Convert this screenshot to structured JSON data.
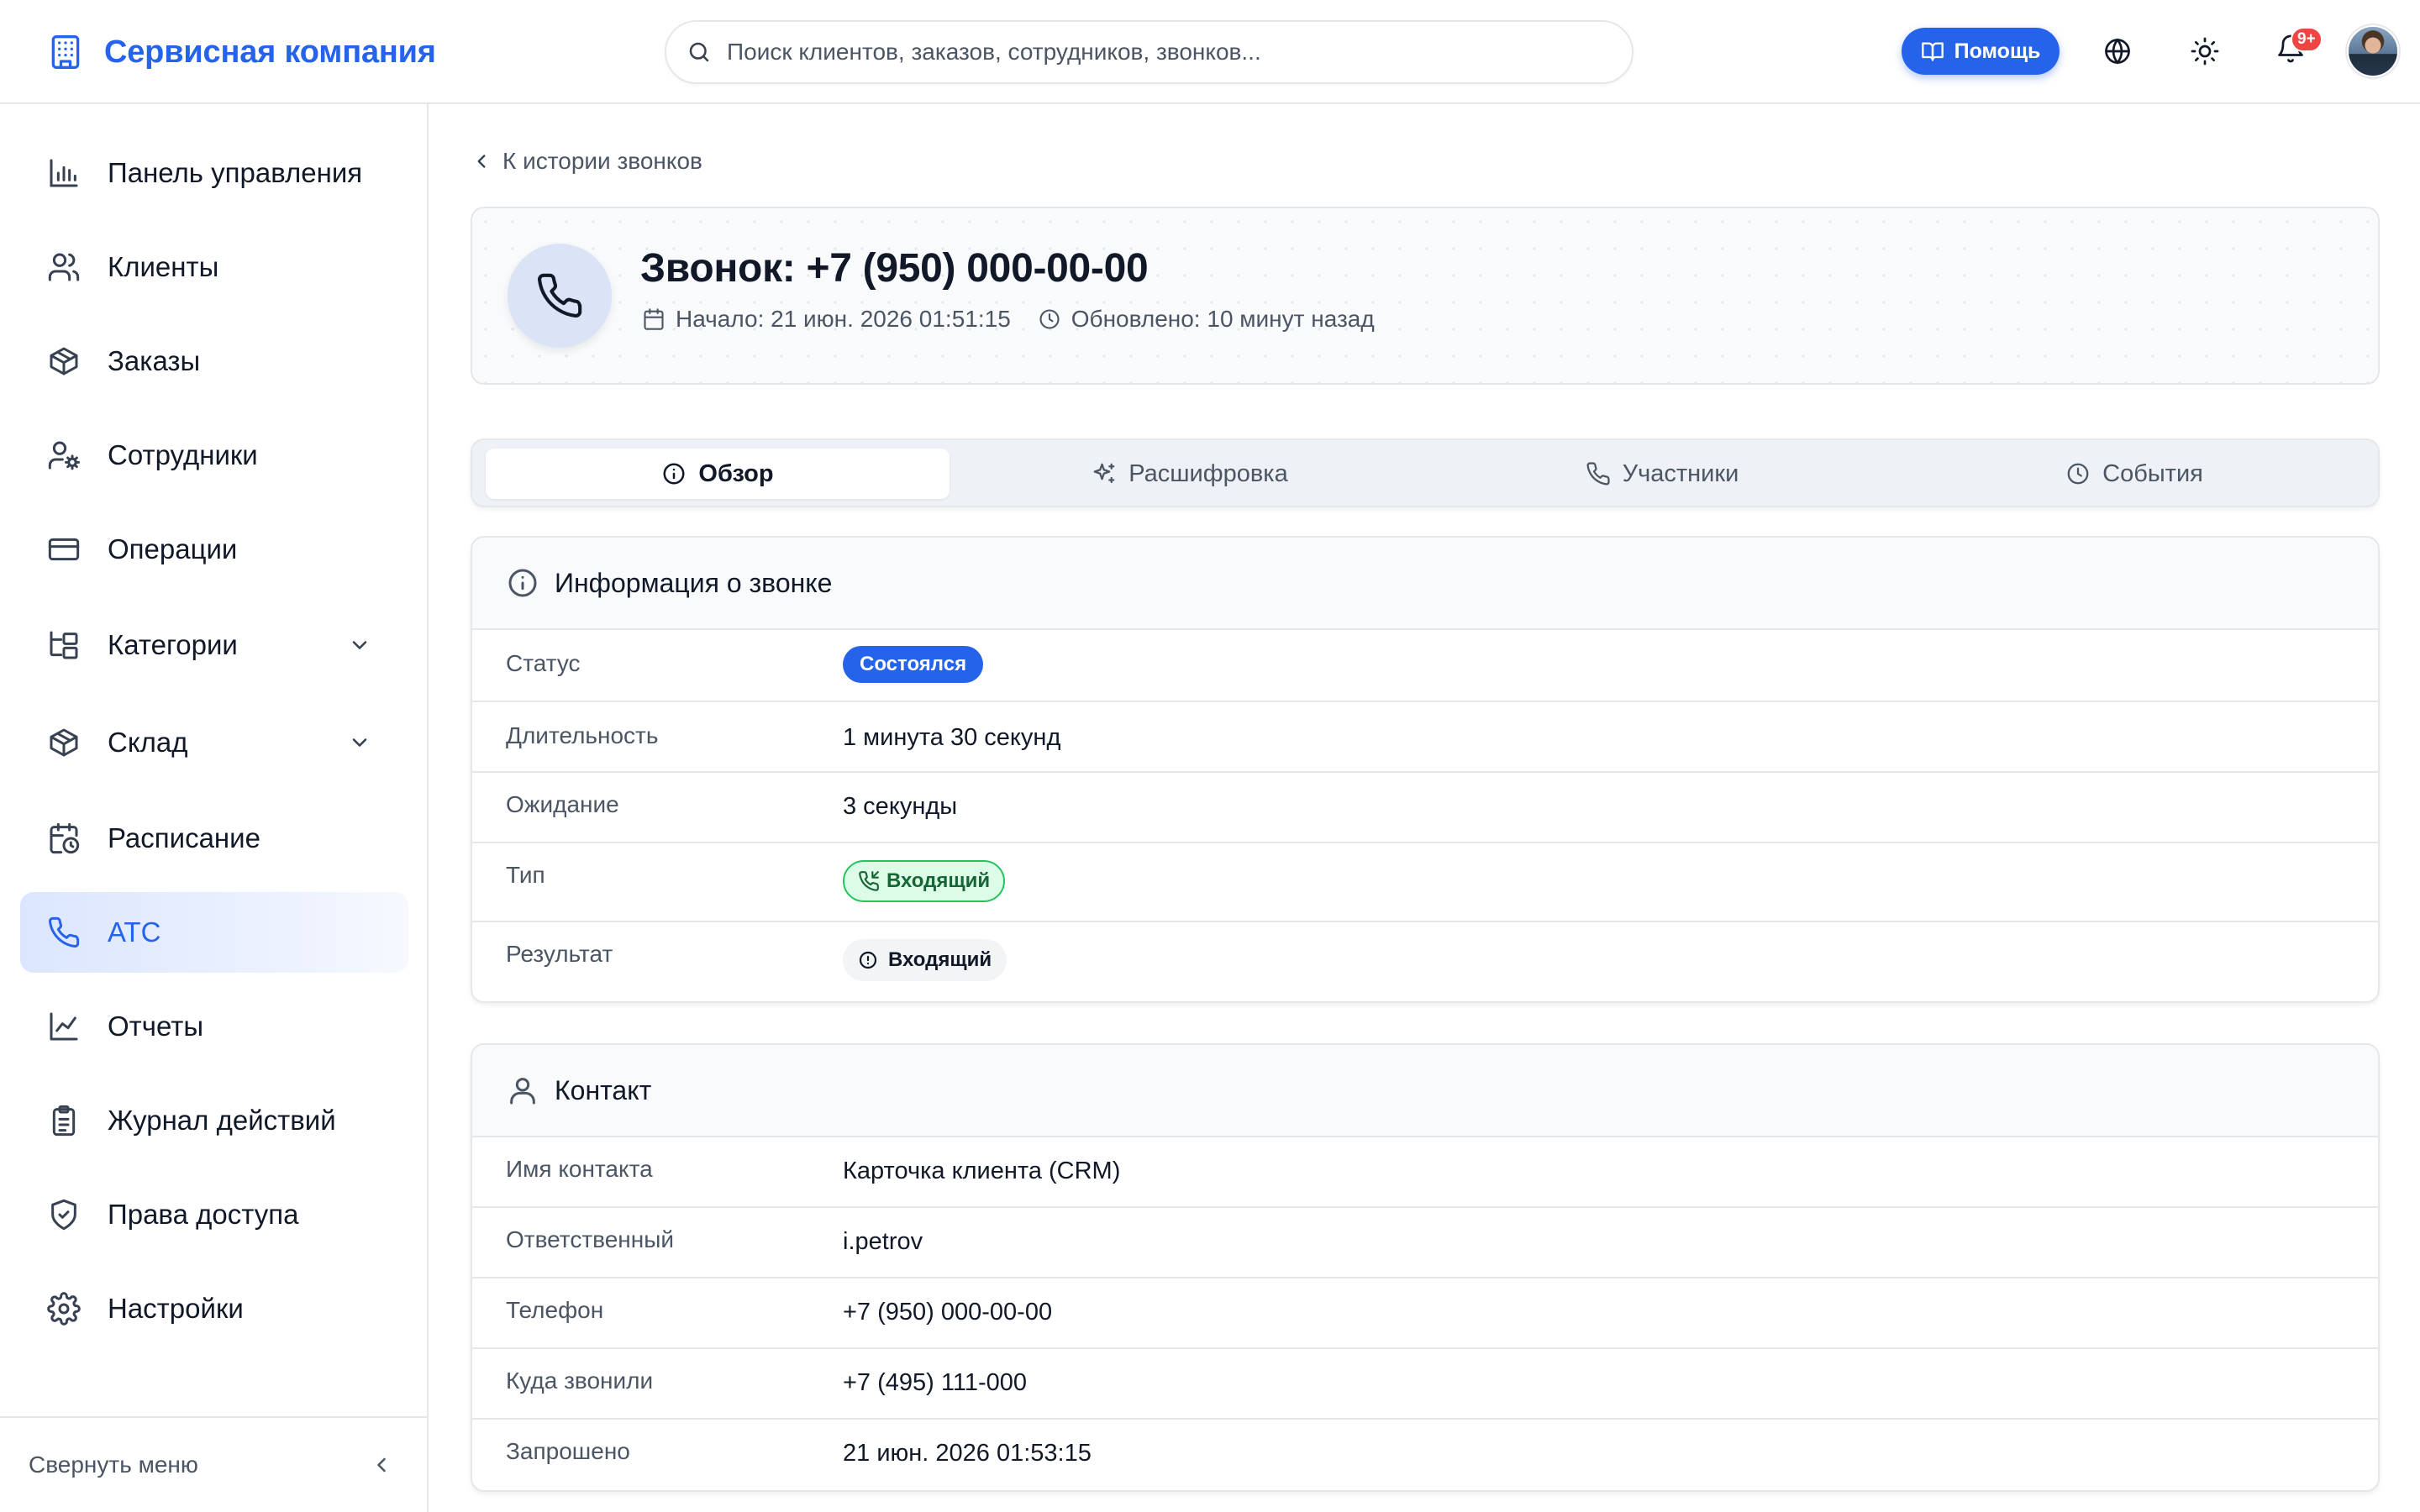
{
  "header": {
    "brand_title": "Сервисная компания",
    "search_placeholder": "Поиск клиентов, заказов, сотрудников, звонков...",
    "help_label": "Помощь",
    "notifications_badge": "9+"
  },
  "sidebar": {
    "items": [
      {
        "label": "Панель управления",
        "icon": "bar-chart-icon"
      },
      {
        "label": "Клиенты",
        "icon": "users-icon"
      },
      {
        "label": "Заказы",
        "icon": "box-icon"
      },
      {
        "label": "Сотрудники",
        "icon": "user-gear-icon"
      },
      {
        "label": "Операции",
        "icon": "credit-card-icon"
      },
      {
        "label": "Категории",
        "icon": "folder-tree-icon",
        "expandable": true
      },
      {
        "label": "Склад",
        "icon": "box-icon",
        "expandable": true
      },
      {
        "label": "Расписание",
        "icon": "calendar-clock-icon"
      },
      {
        "label": "АТС",
        "icon": "phone-icon",
        "active": true
      },
      {
        "label": "Отчеты",
        "icon": "line-chart-icon"
      },
      {
        "label": "Журнал действий",
        "icon": "clipboard-list-icon"
      },
      {
        "label": "Права доступа",
        "icon": "shield-check-icon"
      },
      {
        "label": "Настройки",
        "icon": "gear-icon"
      }
    ],
    "collapse_label": "Свернуть меню"
  },
  "main": {
    "back_label": "К истории звонков",
    "call_title": "Звонок: +7 (950) 000-00-00",
    "started_text": "Начало: 21 июн. 2026 01:51:15",
    "updated_text": "Обновлено: 10 минут назад",
    "tabs": [
      {
        "label": "Обзор",
        "active": true
      },
      {
        "label": "Расшифровка"
      },
      {
        "label": "Участники"
      },
      {
        "label": "События"
      }
    ],
    "call_info": {
      "title": "Информация о звонке",
      "status_label": "Статус",
      "status_value": "Состоялся",
      "duration_label": "Длительность",
      "duration_value": "1 минута 30 секунд",
      "wait_label": "Ожидание",
      "wait_value": "3 секунды",
      "type_label": "Тип",
      "type_value": "Входящий",
      "result_label": "Результат",
      "result_value": "Входящий"
    },
    "contact": {
      "title": "Контакт",
      "rows": [
        {
          "label": "Имя контакта",
          "value": "Карточка клиента (CRM)"
        },
        {
          "label": "Ответственный",
          "value": "i.petrov"
        },
        {
          "label": "Телефон",
          "value": "+7 (950) 000-00-00"
        },
        {
          "label": "Куда звонили",
          "value": "+7 (495) 111-000"
        },
        {
          "label": "Запрошено",
          "value": "21 июн. 2026 01:53:15"
        }
      ]
    }
  },
  "colors": {
    "accent": "#2563eb",
    "success_bg": "#dcfce7",
    "success_border": "#22c55e",
    "badge": "#ef4444"
  }
}
